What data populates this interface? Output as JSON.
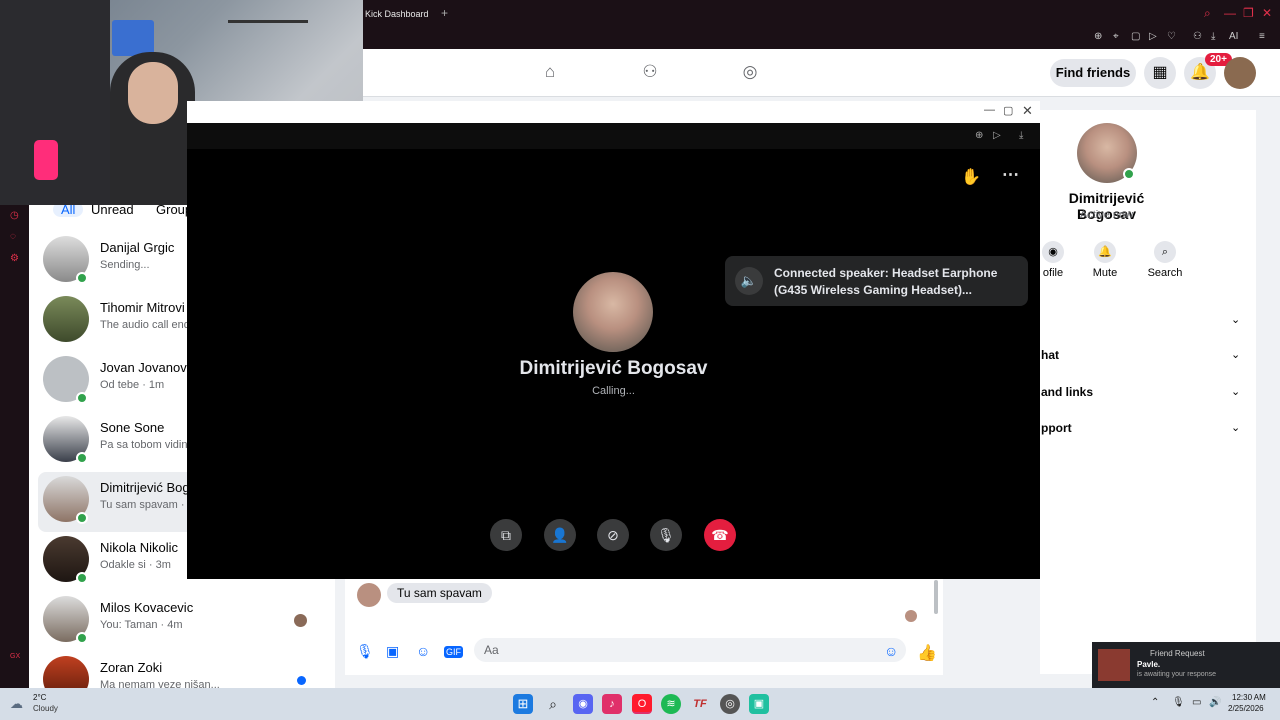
{
  "browser": {
    "tab_title": "Kick Dashboard",
    "new_tab": "+",
    "window_buttons": [
      "⌕",
      "—",
      "❐",
      "✕"
    ],
    "toolbar_ai": "AI"
  },
  "topbar": {
    "find_friends": "Find friends",
    "notif_count": "20+"
  },
  "chat_filters": [
    "All",
    "Unread",
    "Group"
  ],
  "chats": [
    {
      "name": "Danijal Grgic",
      "preview": "Sending...",
      "online": true
    },
    {
      "name": "Tihomir Mitrovi",
      "preview": "The audio call end",
      "online": false
    },
    {
      "name": "Jovan Jovanovi",
      "preview": "Od tebe · 1m",
      "online": true
    },
    {
      "name": "Sone Sone",
      "preview": "Pa sa tobom vidin",
      "online": true
    },
    {
      "name": "Dimitrijević Bog",
      "preview": "Tu sam spavam · 3",
      "online": true
    },
    {
      "name": "Nikola Nikolic",
      "preview": "Odakle si · 3m",
      "online": true
    },
    {
      "name": "Milos Kovacevic",
      "preview": "You: Taman · 4m",
      "online": true
    },
    {
      "name": "Zoran Zoki",
      "preview": "Ma nemam veze nišan...",
      "online": false
    }
  ],
  "call": {
    "url": "OOM:2187578685381373/",
    "caller_name": "Dimitrijević Bogosav",
    "status": "Calling...",
    "speaker_toast": "Connected speaker: Headset Earphone (G435 Wireless Gaming Headset)..."
  },
  "profile": {
    "name": "Dimitrijević Bogosav",
    "status": "Active now",
    "actions": [
      "ofile",
      "Mute",
      "Search"
    ],
    "sections": [
      "",
      "hat",
      "and links",
      "pport"
    ]
  },
  "conversation": {
    "last_message": "Tu sam spavam",
    "composer_placeholder": "Aa"
  },
  "notification": {
    "title": "Friend Request",
    "name": "Pavle.",
    "body": "is awaiting your response"
  },
  "taskbar": {
    "weather_temp": "2°C",
    "weather_desc": "Cloudy",
    "time": "12:30 AM",
    "date": "2/25/2026"
  },
  "colors": {
    "accent": "#0866ff",
    "online": "#31a24c",
    "end_call": "#e41e3f"
  }
}
